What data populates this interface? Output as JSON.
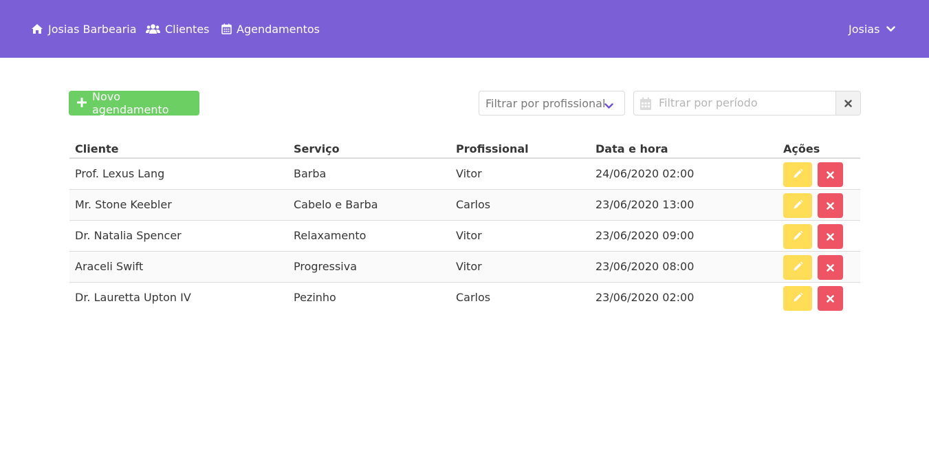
{
  "nav": {
    "brand": "Josias Barbearia",
    "clients": "Clientes",
    "appointments": "Agendamentos",
    "user": "Josias"
  },
  "toolbar": {
    "new_appointment": "Novo agendamento",
    "filter_professional": "Filtrar por profissional",
    "filter_period_placeholder": "Filtrar por período"
  },
  "table": {
    "headers": [
      "Cliente",
      "Serviço",
      "Profissional",
      "Data e hora",
      "Ações"
    ],
    "rows": [
      [
        "Prof. Lexus Lang",
        "Barba",
        "Vitor",
        "24/06/2020 02:00"
      ],
      [
        "Mr. Stone Keebler",
        "Cabelo e Barba",
        "Carlos",
        "23/06/2020 13:00"
      ],
      [
        "Dr. Natalia Spencer",
        "Relaxamento",
        "Vitor",
        "23/06/2020 09:00"
      ],
      [
        "Araceli Swift",
        "Progressiva",
        "Vitor",
        "23/06/2020 08:00"
      ],
      [
        "Dr. Lauretta Upton IV",
        "Pezinho",
        "Carlos",
        "23/06/2020 02:00"
      ]
    ]
  },
  "colors": {
    "navbar": "#7b5fd6",
    "success": "#6ccf63",
    "warning": "#ffdd57",
    "danger": "#ee5464"
  },
  "icons": {
    "brand": "home-icon",
    "clients": "users-icon",
    "appointments": "calendar-icon",
    "user_menu": "chevron-down-icon",
    "new": "plus-icon",
    "select": "chevron-down-icon",
    "period": "calendar-icon",
    "clear": "close-icon",
    "edit": "pencil-icon",
    "delete": "close-icon"
  }
}
